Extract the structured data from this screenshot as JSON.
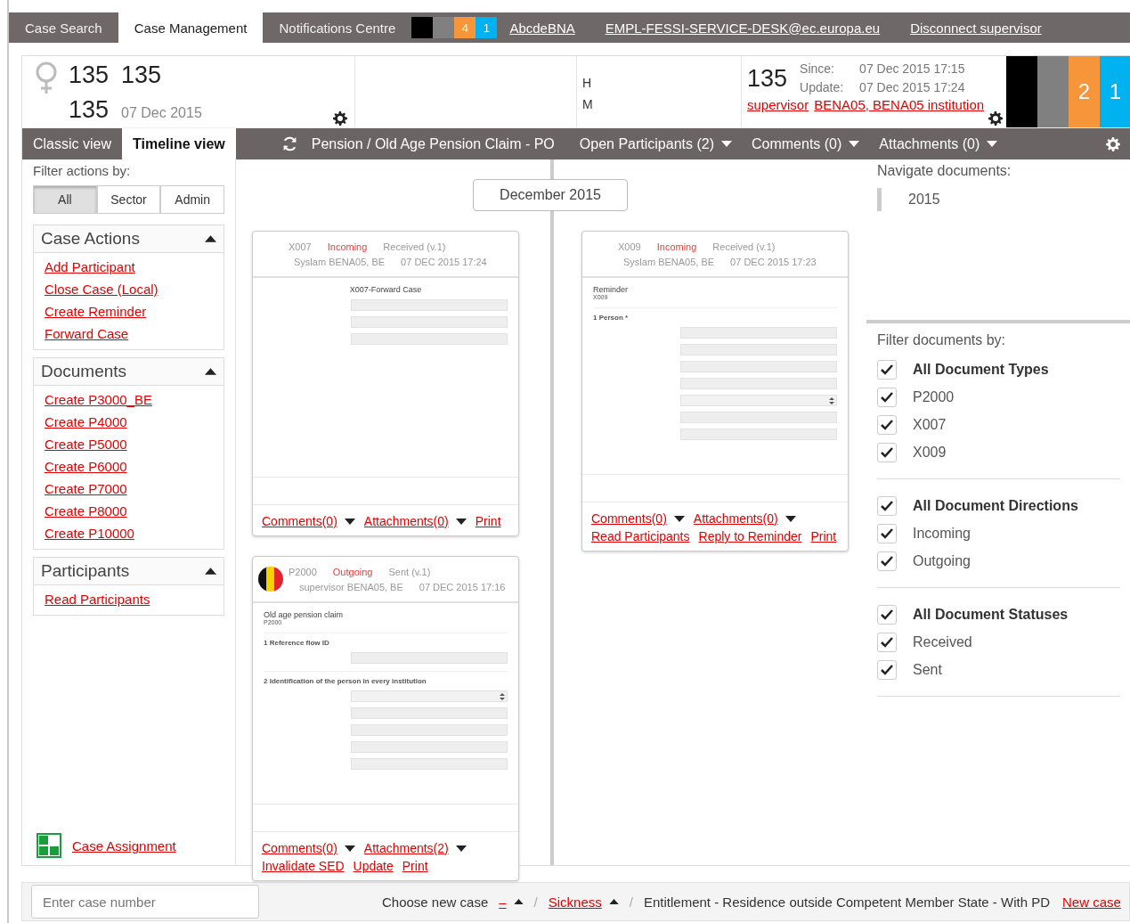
{
  "top_tabs": [
    {
      "label": "Case Search",
      "selected": false
    },
    {
      "label": "Case Management",
      "selected": true
    },
    {
      "label": "Notifications Centre",
      "selected": false
    }
  ],
  "top_badges": [
    {
      "color": "#000000"
    },
    {
      "color": "#808080"
    },
    {
      "color": "#f7953a",
      "count": "4"
    },
    {
      "color": "#00b2ef",
      "count": "1"
    }
  ],
  "user_links": [
    "AbcdeBNA",
    "EMPL-FESSI-SERVICE-DESK@ec.europa.eu",
    "Disconnect supervisor"
  ],
  "case_header": {
    "name_line": [
      "135",
      "135"
    ],
    "id": "135",
    "date": "07 Dec 2015",
    "codes": [
      "H",
      "M"
    ],
    "case_id": "135",
    "since_label": "Since:",
    "since": "07 Dec 2015 17:15",
    "update_label": "Update:",
    "update": "07 Dec 2015 17:24",
    "owner_links": [
      "supervisor",
      "BENA05, BENA05 institution"
    ],
    "blocks": [
      {
        "color": "#000000"
      },
      {
        "color": "#808080"
      },
      {
        "color": "#f7953a",
        "count": "2"
      },
      {
        "color": "#00b2ef",
        "count": "1"
      }
    ]
  },
  "view_tabs": [
    {
      "label": "Classic view",
      "selected": false
    },
    {
      "label": "Timeline view",
      "selected": true
    }
  ],
  "toolbar": {
    "case_type": "Pension / Old Age Pension Claim - PO",
    "menus": [
      "Open Participants (2)",
      "Comments (0)",
      "Attachments (0)"
    ]
  },
  "sidebar": {
    "filter_label": "Filter actions by:",
    "filters": [
      {
        "label": "All",
        "selected": true
      },
      {
        "label": "Sector",
        "selected": false
      },
      {
        "label": "Admin",
        "selected": false
      }
    ],
    "panels": [
      {
        "title": "Case Actions",
        "expanded": true,
        "links": [
          "Add Participant",
          "Close Case (Local)",
          "Create Reminder",
          "Forward Case"
        ]
      },
      {
        "title": "Documents",
        "expanded": true,
        "links": [
          "Create P3000_BE",
          "Create P4000",
          "Create P5000",
          "Create P6000",
          "Create P7000",
          "Create P8000",
          "Create P10000"
        ]
      },
      {
        "title": "Participants",
        "expanded": true,
        "links": [
          "Read Participants"
        ]
      }
    ],
    "assignment": "Case Assignment"
  },
  "timeline": {
    "month": "December 2015",
    "columns": [
      [
        {
          "code": "X007",
          "direction": "Incoming",
          "status": "Received (v.1)",
          "sender": "Syslam",
          "institution": "BENA05, BE",
          "date": "07 DEC 2015 17:24",
          "flag": false,
          "form": {
            "title": "X007-Forward Case",
            "centered": true,
            "sections": [
              {
                "fields": [
                  {
                    "kind": "input"
                  },
                  {
                    "kind": "input"
                  },
                  {
                    "kind": "input"
                  }
                ]
              }
            ]
          },
          "actions": [
            {
              "label": "Comments(0)",
              "kind": "dropdown"
            },
            {
              "label": "Attachments(0)",
              "kind": "dropdown"
            },
            {
              "label": "Print",
              "kind": "link"
            }
          ]
        },
        {
          "code": "P2000",
          "direction": "Outgoing",
          "status": "Sent (v.1)",
          "sender": "supervisor",
          "institution": "BENA05, BE",
          "date": "07 DEC 2015 17:16",
          "flag": true,
          "form": {
            "title": "Old age pension claim",
            "subtitle": "P2000",
            "centered": false,
            "sections": [
              {
                "heading": "1 Reference flow ID",
                "fields": [
                  {
                    "kind": "input"
                  }
                ]
              },
              {
                "heading": "2 Identification of the person in every institution",
                "fields": [
                  {
                    "kind": "select"
                  },
                  {
                    "kind": "input"
                  },
                  {
                    "kind": "input"
                  },
                  {
                    "kind": "input"
                  },
                  {
                    "kind": "input"
                  }
                ]
              }
            ]
          },
          "actions": [
            {
              "label": "Comments(0)",
              "kind": "dropdown"
            },
            {
              "label": "Attachments(2)",
              "kind": "dropdown"
            },
            {
              "label": "Invalidate SED",
              "kind": "link"
            },
            {
              "label": "Update",
              "kind": "link"
            },
            {
              "label": "Print",
              "kind": "link"
            }
          ]
        }
      ],
      [
        {
          "code": "X009",
          "direction": "Incoming",
          "status": "Received (v.1)",
          "sender": "Syslam",
          "institution": "BENA05, BE",
          "date": "07 DEC 2015 17:23",
          "flag": false,
          "form": {
            "title": "Reminder",
            "subtitle": "X009",
            "centered": false,
            "sections": [
              {
                "heading": "1 Person *",
                "fields": [
                  {
                    "kind": "input"
                  },
                  {
                    "kind": "input"
                  },
                  {
                    "kind": "input"
                  },
                  {
                    "kind": "input"
                  },
                  {
                    "kind": "select"
                  },
                  {
                    "kind": "input"
                  },
                  {
                    "kind": "input"
                  }
                ]
              }
            ]
          },
          "actions": [
            {
              "label": "Comments(0)",
              "kind": "dropdown"
            },
            {
              "label": "Attachments(0)",
              "kind": "dropdown"
            },
            {
              "label": "Read Participants",
              "kind": "link"
            },
            {
              "label": "Reply to Reminder",
              "kind": "link"
            },
            {
              "label": "Print",
              "kind": "link"
            }
          ]
        }
      ]
    ]
  },
  "navigator": {
    "title": "Navigate documents:",
    "years": [
      "2015"
    ]
  },
  "doc_filters": {
    "title": "Filter documents by:",
    "groups": [
      {
        "label": "All Document Types",
        "checked": true,
        "items": [
          {
            "label": "P2000",
            "checked": true
          },
          {
            "label": "X007",
            "checked": true
          },
          {
            "label": "X009",
            "checked": true
          }
        ]
      },
      {
        "label": "All Document Directions",
        "checked": true,
        "items": [
          {
            "label": "Incoming",
            "checked": true
          },
          {
            "label": "Outgoing",
            "checked": true
          }
        ]
      },
      {
        "label": "All Document Statuses",
        "checked": true,
        "items": [
          {
            "label": "Received",
            "checked": true
          },
          {
            "label": "Sent",
            "checked": true
          }
        ]
      }
    ]
  },
  "footer": {
    "placeholder": "Enter case number",
    "choose_label": "Choose new case",
    "crumbs": [
      {
        "label": "–",
        "kind": "link"
      },
      {
        "label": "Sickness",
        "kind": "link"
      },
      {
        "label": "Entitlement - Residence outside Competent Member State - With PD",
        "kind": "text"
      }
    ],
    "new_case": "New case",
    "separator": "/"
  }
}
